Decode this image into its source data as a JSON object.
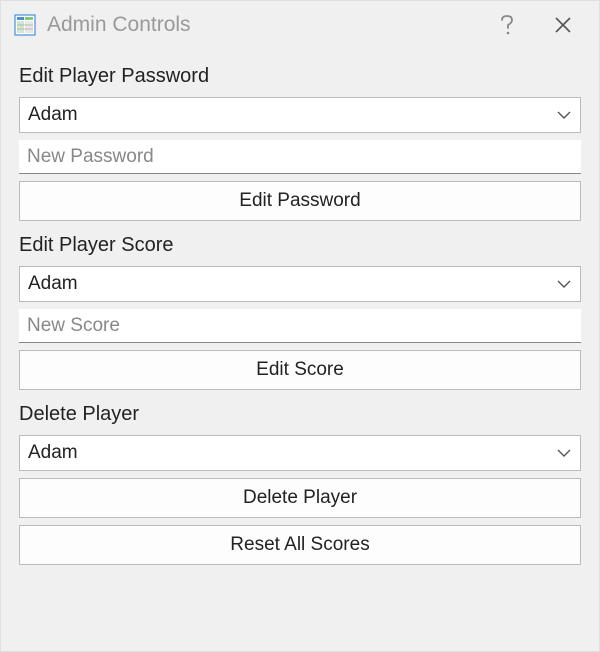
{
  "window": {
    "title": "Admin Controls"
  },
  "sections": {
    "edit_password": {
      "label": "Edit Player Password",
      "selected_player": "Adam",
      "password_placeholder": "New Password",
      "button_label": "Edit Password"
    },
    "edit_score": {
      "label": "Edit Player Score",
      "selected_player": "Adam",
      "score_placeholder": "New Score",
      "button_label": "Edit Score"
    },
    "delete_player": {
      "label": "Delete Player",
      "selected_player": "Adam",
      "button_label": "Delete Player"
    },
    "reset": {
      "button_label": "Reset All Scores"
    }
  }
}
